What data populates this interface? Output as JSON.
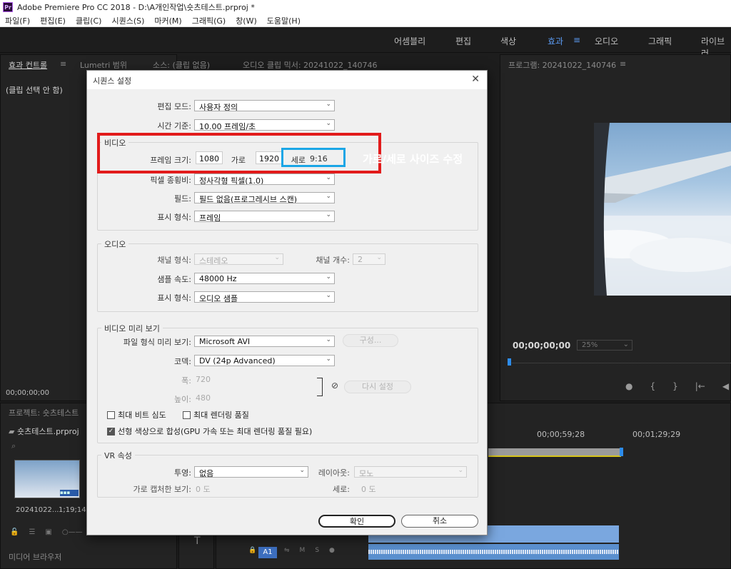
{
  "window": {
    "title": "Adobe Premiere Pro CC 2018 - D:\\A개인작업\\숏츠테스트.prproj *",
    "logo": "Pr"
  },
  "menu": [
    "파일(F)",
    "편집(E)",
    "클립(C)",
    "시퀀스(S)",
    "마커(M)",
    "그래픽(G)",
    "창(W)",
    "도움말(H)"
  ],
  "workspaces": {
    "items": [
      "어셈블리",
      "편집",
      "색상",
      "효과",
      "오디오",
      "그래픽",
      "라이브러"
    ],
    "active": "효과",
    "menu_icon": "≡"
  },
  "source_panel": {
    "tabs": [
      "효과 컨트롤",
      "Lumetri 범위",
      "소스: (클립 없음)",
      "오디오 클립 믹서: 20241022_140746"
    ],
    "empty_text": "(클립 선택 안 함)",
    "timecode": "00;00;00;00"
  },
  "program_monitor": {
    "title": "프로그램: 20241022_140746",
    "timecode": "00;00;00;00",
    "zoom": "25%"
  },
  "project_panel": {
    "title": "프로젝트: 숏츠테스트",
    "bin_name": "숏츠테스트.prproj",
    "clip_name": "20241022...",
    "clip_duration": "1;19;14",
    "bottom_tab": "미디어 브라우저"
  },
  "timeline": {
    "ticks": [
      "00;00;59;28",
      "00;01;29;29"
    ],
    "track_label": "A1"
  },
  "dialog": {
    "title": "시퀀스 설정",
    "close": "✕",
    "edit_mode": {
      "label": "편집 모드:",
      "value": "사용자 정의"
    },
    "timebase": {
      "label": "시간 기준:",
      "value": "10.00  프레임/초"
    },
    "video": {
      "title": "비디오",
      "frame_size_label": "프레임 크기:",
      "width": "1080",
      "horizontal_label": "가로",
      "height": "1920",
      "vertical_label": "세로",
      "aspect": "9:16",
      "pixel_aspect_label": "픽셀 종횡비:",
      "pixel_aspect_value": "정사각형 픽셀(1.0)",
      "fields_label": "필드:",
      "fields_value": "필드 없음(프로그레시브 스캔)",
      "display_label": "표시 형식:",
      "display_value": "프레임"
    },
    "audio": {
      "title": "오디오",
      "channel_label": "채널 형식:",
      "channel_value": "스테레오",
      "count_label": "채널 개수:",
      "count_value": "2",
      "rate_label": "샘플 속도:",
      "rate_value": "48000 Hz",
      "display_label": "표시 형식:",
      "display_value": "오디오 샘플"
    },
    "preview": {
      "title": "비디오 미리 보기",
      "format_label": "파일 형식 미리 보기:",
      "format_value": "Microsoft AVI",
      "config_button": "구성...",
      "codec_label": "코덱:",
      "codec_value": "DV (24p Advanced)",
      "width_label": "폭:",
      "width_value": "720",
      "height_label": "높이:",
      "height_value": "480",
      "reset_button": "다시 설정",
      "max_bit_depth": "최대 비트 심도",
      "max_render_quality": "최대 렌더링 품질",
      "linear_color": "선형 색상으로 합성(GPU 가속 또는 최대 렌더링 품질 필요)",
      "linear_color_checked": true
    },
    "vr": {
      "title": "VR 속성",
      "projection_label": "투영:",
      "projection_value": "없음",
      "layout_label": "레이아웃:",
      "layout_value": "모노",
      "hfov_label": "가로 캡처한 보기:",
      "hfov_value": "0 도",
      "vfov_label": "세로:",
      "vfov_value": "0 도"
    },
    "ok": "확인",
    "cancel": "취소"
  },
  "annotation": {
    "text": "가로/세로 사이즈 수정",
    "red": "#e21b1b",
    "blue": "#1aa6e6"
  }
}
